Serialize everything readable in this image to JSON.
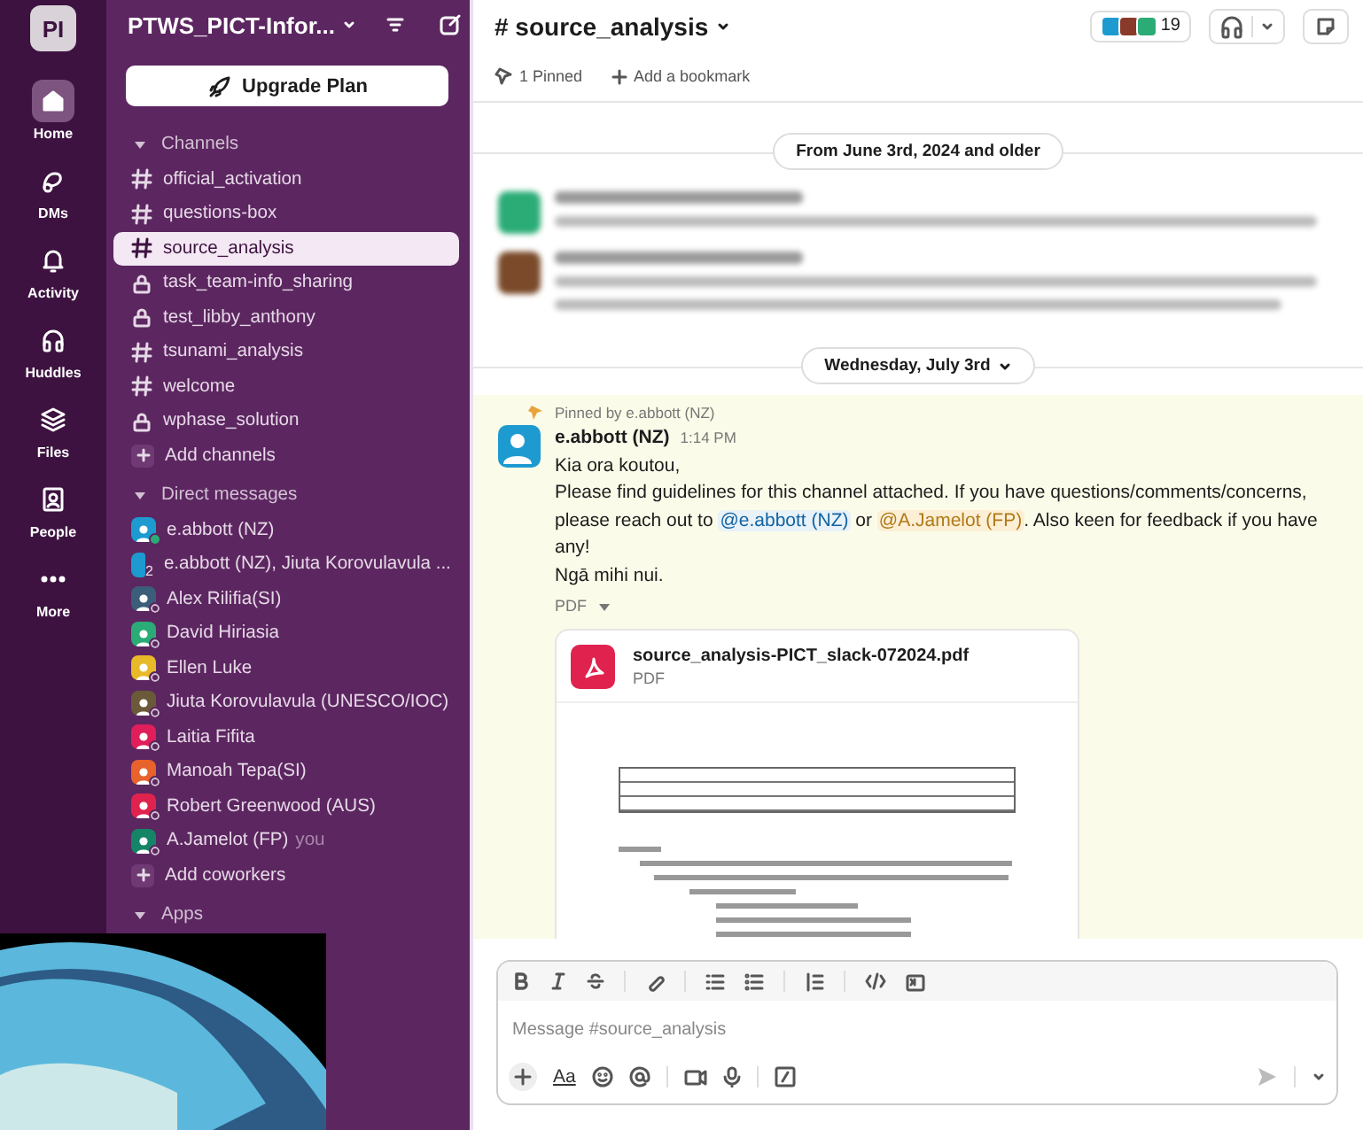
{
  "workspace": {
    "initials": "PI",
    "name": "PTWS_PICT-Infor..."
  },
  "rail": [
    {
      "label": "Home",
      "selected": true
    },
    {
      "label": "DMs",
      "selected": false
    },
    {
      "label": "Activity",
      "selected": false
    },
    {
      "label": "Huddles",
      "selected": false
    },
    {
      "label": "Files",
      "selected": false
    },
    {
      "label": "People",
      "selected": false
    },
    {
      "label": "More",
      "selected": false
    }
  ],
  "upgrade_button": "Upgrade Plan",
  "sections": [
    {
      "title": "Channels",
      "expanded": true,
      "items": [
        {
          "kind": "channel",
          "label": "official_activation",
          "private": false,
          "selected": false
        },
        {
          "kind": "channel",
          "label": "questions-box",
          "private": false,
          "selected": false
        },
        {
          "kind": "channel",
          "label": "source_analysis",
          "private": false,
          "selected": true
        },
        {
          "kind": "channel",
          "label": "task_team-info_sharing",
          "private": true,
          "selected": false
        },
        {
          "kind": "channel",
          "label": "test_libby_anthony",
          "private": true,
          "selected": false
        },
        {
          "kind": "channel",
          "label": "tsunami_analysis",
          "private": false,
          "selected": false
        },
        {
          "kind": "channel",
          "label": "welcome",
          "private": false,
          "selected": false
        },
        {
          "kind": "channel",
          "label": "wphase_solution",
          "private": true,
          "selected": false
        },
        {
          "kind": "add",
          "label": "Add channels"
        }
      ]
    },
    {
      "title": "Direct messages",
      "expanded": true,
      "items": [
        {
          "kind": "dm",
          "label": "e.abbott (NZ)",
          "color": "#1d9bd1",
          "online": true
        },
        {
          "kind": "group",
          "label": "e.abbott (NZ), Jiuta Korovulavula ...",
          "color": "#1d9bd1",
          "count": "2"
        },
        {
          "kind": "dm",
          "label": "Alex Rilifia(SI)",
          "color": "#3b5e7a",
          "online": false
        },
        {
          "kind": "dm",
          "label": "David Hiriasia",
          "color": "#2bac76",
          "online": false
        },
        {
          "kind": "dm",
          "label": "Ellen Luke",
          "color": "#e8b928",
          "online": false
        },
        {
          "kind": "dm",
          "label": "Jiuta Korovulavula (UNESCO/IOC)",
          "color": "#6b5a3a",
          "online": false
        },
        {
          "kind": "dm",
          "label": "Laitia Fifita",
          "color": "#e01e5a",
          "online": false
        },
        {
          "kind": "dm",
          "label": "Manoah Tepa(SI)",
          "color": "#e8622c",
          "online": false
        },
        {
          "kind": "dm",
          "label": "Robert Greenwood (AUS)",
          "color": "#e0234e",
          "online": false
        },
        {
          "kind": "dm",
          "label": "A.Jamelot (FP)",
          "suffix": "you",
          "color": "#148567",
          "online": false
        },
        {
          "kind": "add",
          "label": "Add coworkers"
        }
      ]
    },
    {
      "title": "Apps",
      "expanded": true
    }
  ],
  "channel_header": {
    "name": "# source_analysis",
    "member_count": "19",
    "pinned": "1 Pinned",
    "bookmark": "Add a bookmark"
  },
  "feed": [
    {
      "kind": "divider",
      "label": "From June 3rd, 2024 and older",
      "menu": false
    },
    {
      "kind": "blurred",
      "color": "#2bac76"
    },
    {
      "kind": "blurred_thread",
      "color": "#7a4a2a"
    },
    {
      "kind": "divider",
      "label": "Wednesday, July 3rd",
      "menu": true
    },
    {
      "kind": "message",
      "pinned_by": "Pinned by e.abbott (NZ)",
      "author": "e.abbott (NZ)",
      "time": "1:14 PM",
      "color": "#1d9bd1",
      "paragraphs": [
        [
          {
            "text": "Kia ora koutou,"
          }
        ],
        [
          {
            "text": "Please find guidelines for this channel attached. If you have questions/comments/concerns, please reach out to "
          },
          {
            "mention": "@e.abbott (NZ)",
            "self": false
          },
          {
            "text": " or "
          },
          {
            "mention": "@A.Jamelot (FP)",
            "self": true
          },
          {
            "text": ". Also keen for feedback if you have any!"
          }
        ],
        [
          {
            "text": "Ngā mihi nui."
          }
        ]
      ],
      "attachment": {
        "label": "PDF",
        "file_name": "source_analysis-PICT_slack-072024.pdf",
        "file_type": "PDF"
      }
    }
  ],
  "composer": {
    "placeholder": "Message #source_analysis",
    "format_label": "Aa"
  }
}
